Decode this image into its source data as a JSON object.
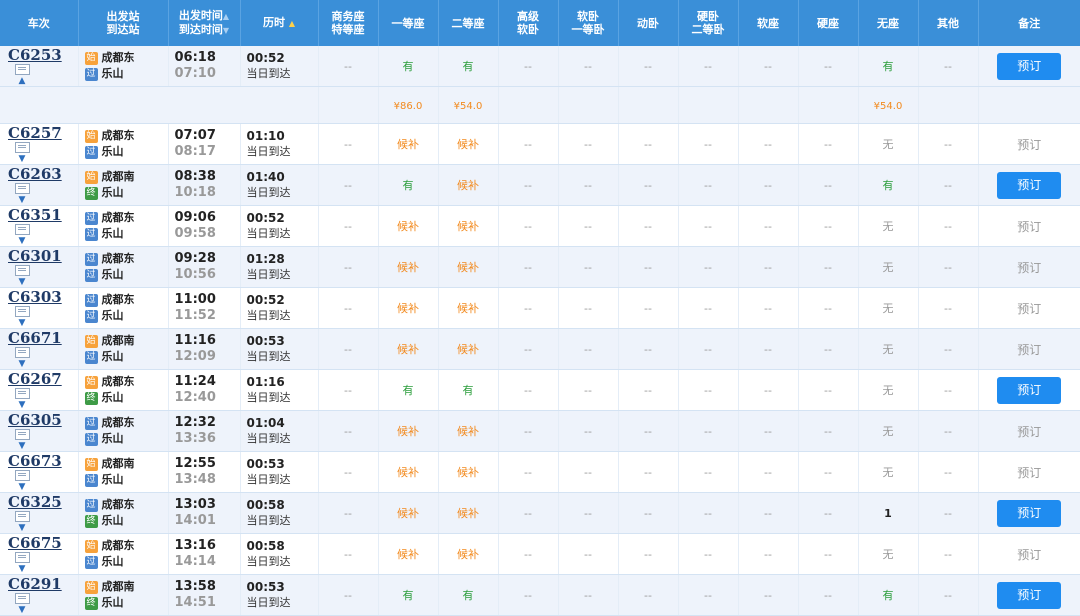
{
  "headers": {
    "train": "车次",
    "station_from": "出发站",
    "station_to": "到达站",
    "dep_time": "出发时间",
    "arr_time": "到达时间",
    "duration": "历时",
    "business_1": "商务座",
    "business_2": "特等座",
    "first": "一等座",
    "second": "二等座",
    "gj_1": "高级",
    "gj_2": "软卧",
    "rw_1": "软卧",
    "rw_2": "一等卧",
    "dw": "动卧",
    "yw_1": "硬卧",
    "yw_2": "二等卧",
    "rz": "软座",
    "yz": "硬座",
    "wz": "无座",
    "other": "其他",
    "remark": "备注"
  },
  "sort_icons": {
    "up": "▲",
    "down": "▼"
  },
  "dash": "--",
  "book_label": "预订",
  "arrive_label": "当日到达",
  "badge_text": {
    "shi": "始",
    "guo": "过",
    "zhong": "终"
  },
  "price_row": {
    "first": "¥86.0",
    "second": "¥54.0",
    "wz": "¥54.0"
  },
  "trains": [
    {
      "no": "C6253",
      "from_badge": "始",
      "from": "成都东",
      "to_badge": "过",
      "to": "乐山",
      "dep": "06:18",
      "arr": "07:10",
      "dur": "00:52",
      "first": "有",
      "second": "有",
      "wz": "有",
      "book": "预订",
      "book_active": true
    },
    {
      "no": "C6257",
      "from_badge": "始",
      "from": "成都东",
      "to_badge": "过",
      "to": "乐山",
      "dep": "07:07",
      "arr": "08:17",
      "dur": "01:10",
      "first": "候补",
      "second": "候补",
      "wz": "无",
      "book": "预订",
      "book_active": false
    },
    {
      "no": "C6263",
      "from_badge": "始",
      "from": "成都南",
      "to_badge": "终",
      "to": "乐山",
      "dep": "08:38",
      "arr": "10:18",
      "dur": "01:40",
      "first": "有",
      "second": "候补",
      "wz": "有",
      "book": "预订",
      "book_active": true
    },
    {
      "no": "C6351",
      "from_badge": "过",
      "from": "成都东",
      "to_badge": "过",
      "to": "乐山",
      "dep": "09:06",
      "arr": "09:58",
      "dur": "00:52",
      "first": "候补",
      "second": "候补",
      "wz": "无",
      "book": "预订",
      "book_active": false
    },
    {
      "no": "C6301",
      "from_badge": "过",
      "from": "成都东",
      "to_badge": "过",
      "to": "乐山",
      "dep": "09:28",
      "arr": "10:56",
      "dur": "01:28",
      "first": "候补",
      "second": "候补",
      "wz": "无",
      "book": "预订",
      "book_active": false
    },
    {
      "no": "C6303",
      "from_badge": "过",
      "from": "成都东",
      "to_badge": "过",
      "to": "乐山",
      "dep": "11:00",
      "arr": "11:52",
      "dur": "00:52",
      "first": "候补",
      "second": "候补",
      "wz": "无",
      "book": "预订",
      "book_active": false
    },
    {
      "no": "C6671",
      "from_badge": "始",
      "from": "成都南",
      "to_badge": "过",
      "to": "乐山",
      "dep": "11:16",
      "arr": "12:09",
      "dur": "00:53",
      "first": "候补",
      "second": "候补",
      "wz": "无",
      "book": "预订",
      "book_active": false
    },
    {
      "no": "C6267",
      "from_badge": "始",
      "from": "成都东",
      "to_badge": "终",
      "to": "乐山",
      "dep": "11:24",
      "arr": "12:40",
      "dur": "01:16",
      "first": "有",
      "second": "有",
      "wz": "无",
      "book": "预订",
      "book_active": true
    },
    {
      "no": "C6305",
      "from_badge": "过",
      "from": "成都东",
      "to_badge": "过",
      "to": "乐山",
      "dep": "12:32",
      "arr": "13:36",
      "dur": "01:04",
      "first": "候补",
      "second": "候补",
      "wz": "无",
      "book": "预订",
      "book_active": false
    },
    {
      "no": "C6673",
      "from_badge": "始",
      "from": "成都南",
      "to_badge": "过",
      "to": "乐山",
      "dep": "12:55",
      "arr": "13:48",
      "dur": "00:53",
      "first": "候补",
      "second": "候补",
      "wz": "无",
      "book": "预订",
      "book_active": false
    },
    {
      "no": "C6325",
      "from_badge": "过",
      "from": "成都东",
      "to_badge": "终",
      "to": "乐山",
      "dep": "13:03",
      "arr": "14:01",
      "dur": "00:58",
      "first": "候补",
      "second": "候补",
      "wz": "1",
      "book": "预订",
      "book_active": true
    },
    {
      "no": "C6675",
      "from_badge": "始",
      "from": "成都东",
      "to_badge": "过",
      "to": "乐山",
      "dep": "13:16",
      "arr": "14:14",
      "dur": "00:58",
      "first": "候补",
      "second": "候补",
      "wz": "无",
      "book": "预订",
      "book_active": false
    },
    {
      "no": "C6291",
      "from_badge": "始",
      "from": "成都南",
      "to_badge": "终",
      "to": "乐山",
      "dep": "13:58",
      "arr": "14:51",
      "dur": "00:53",
      "first": "有",
      "second": "有",
      "wz": "有",
      "book": "预订",
      "book_active": true
    }
  ],
  "colors": {
    "header_bg": "#3a8fd8",
    "book_button": "#1f8cf0",
    "available": "#2a9d3a",
    "waitlist": "#f28a1e",
    "alt_row": "#eef3fb"
  }
}
